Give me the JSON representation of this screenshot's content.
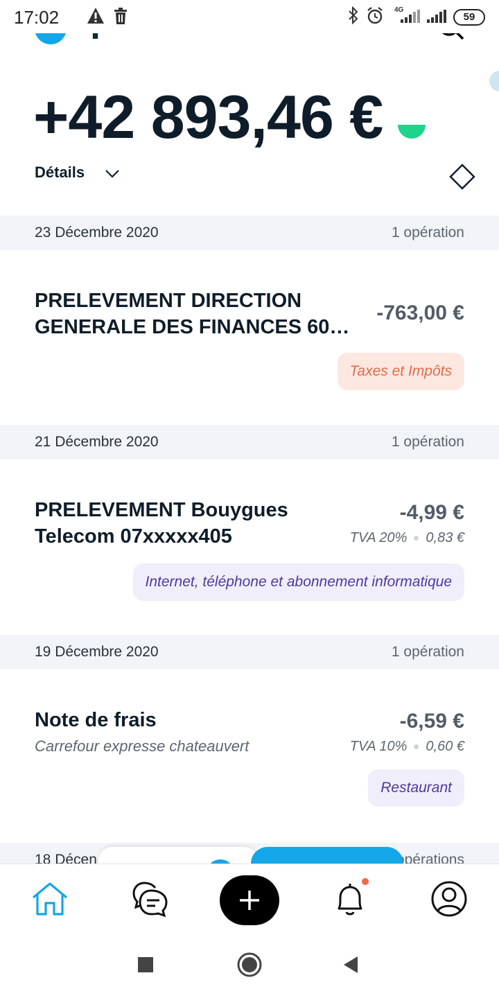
{
  "status_bar": {
    "time": "17:02",
    "network": "4G",
    "battery": "59",
    "icons": [
      "warning-icon",
      "trash-icon",
      "bluetooth-icon",
      "alarm-icon",
      "signal-icon",
      "signal-icon",
      "battery-icon"
    ]
  },
  "header": {
    "app_name": "qonto",
    "balance": "+42 893,46 €",
    "details_label": "Détails"
  },
  "colors": {
    "accent": "#13a6e8",
    "positive": "#1ed38a",
    "tax_chip_bg": "#fde8e1",
    "tax_chip_text": "#e06a4a",
    "purple_chip_bg": "#f1eefb",
    "purple_chip_text": "#4b3aa0"
  },
  "groups": [
    {
      "date": "23 Décembre 2020",
      "count": "1 opération",
      "transaction": {
        "title": "PRELEVEMENT DIRECTION GENERALE DES FINANCES 60…",
        "title_line1": "PRELEVEMENT DIRECTION",
        "title_line2": "GENERALE DES FINANCES 60…",
        "amount": "-763,00 €",
        "category": "Taxes et Impôts"
      }
    },
    {
      "date": "21 Décembre 2020",
      "count": "1 opération",
      "transaction": {
        "title_line1": "PRELEVEMENT Bouygues",
        "title_line2": "Telecom 07xxxxx405",
        "amount": "-4,99 €",
        "tva_rate": "TVA 20%",
        "tva_amount": "0,83 €",
        "category": "Internet, téléphone et abonnement informatique"
      }
    },
    {
      "date": "19 Décembre 2020",
      "count": "1 opération",
      "transaction": {
        "title": "Note de frais",
        "subtitle": "Carrefour expresse chateauvert",
        "amount": "-6,59 €",
        "tva_rate": "TVA 10%",
        "tva_amount": "0,60 €",
        "category": "Restaurant"
      }
    },
    {
      "date": "18 Décen",
      "count": "opérations"
    }
  ],
  "bottom_nav": [
    "home-icon",
    "chat-icon",
    "add-icon",
    "bell-icon",
    "profile-icon"
  ],
  "system_nav": [
    "recents-icon",
    "home-circle-icon",
    "back-icon"
  ]
}
